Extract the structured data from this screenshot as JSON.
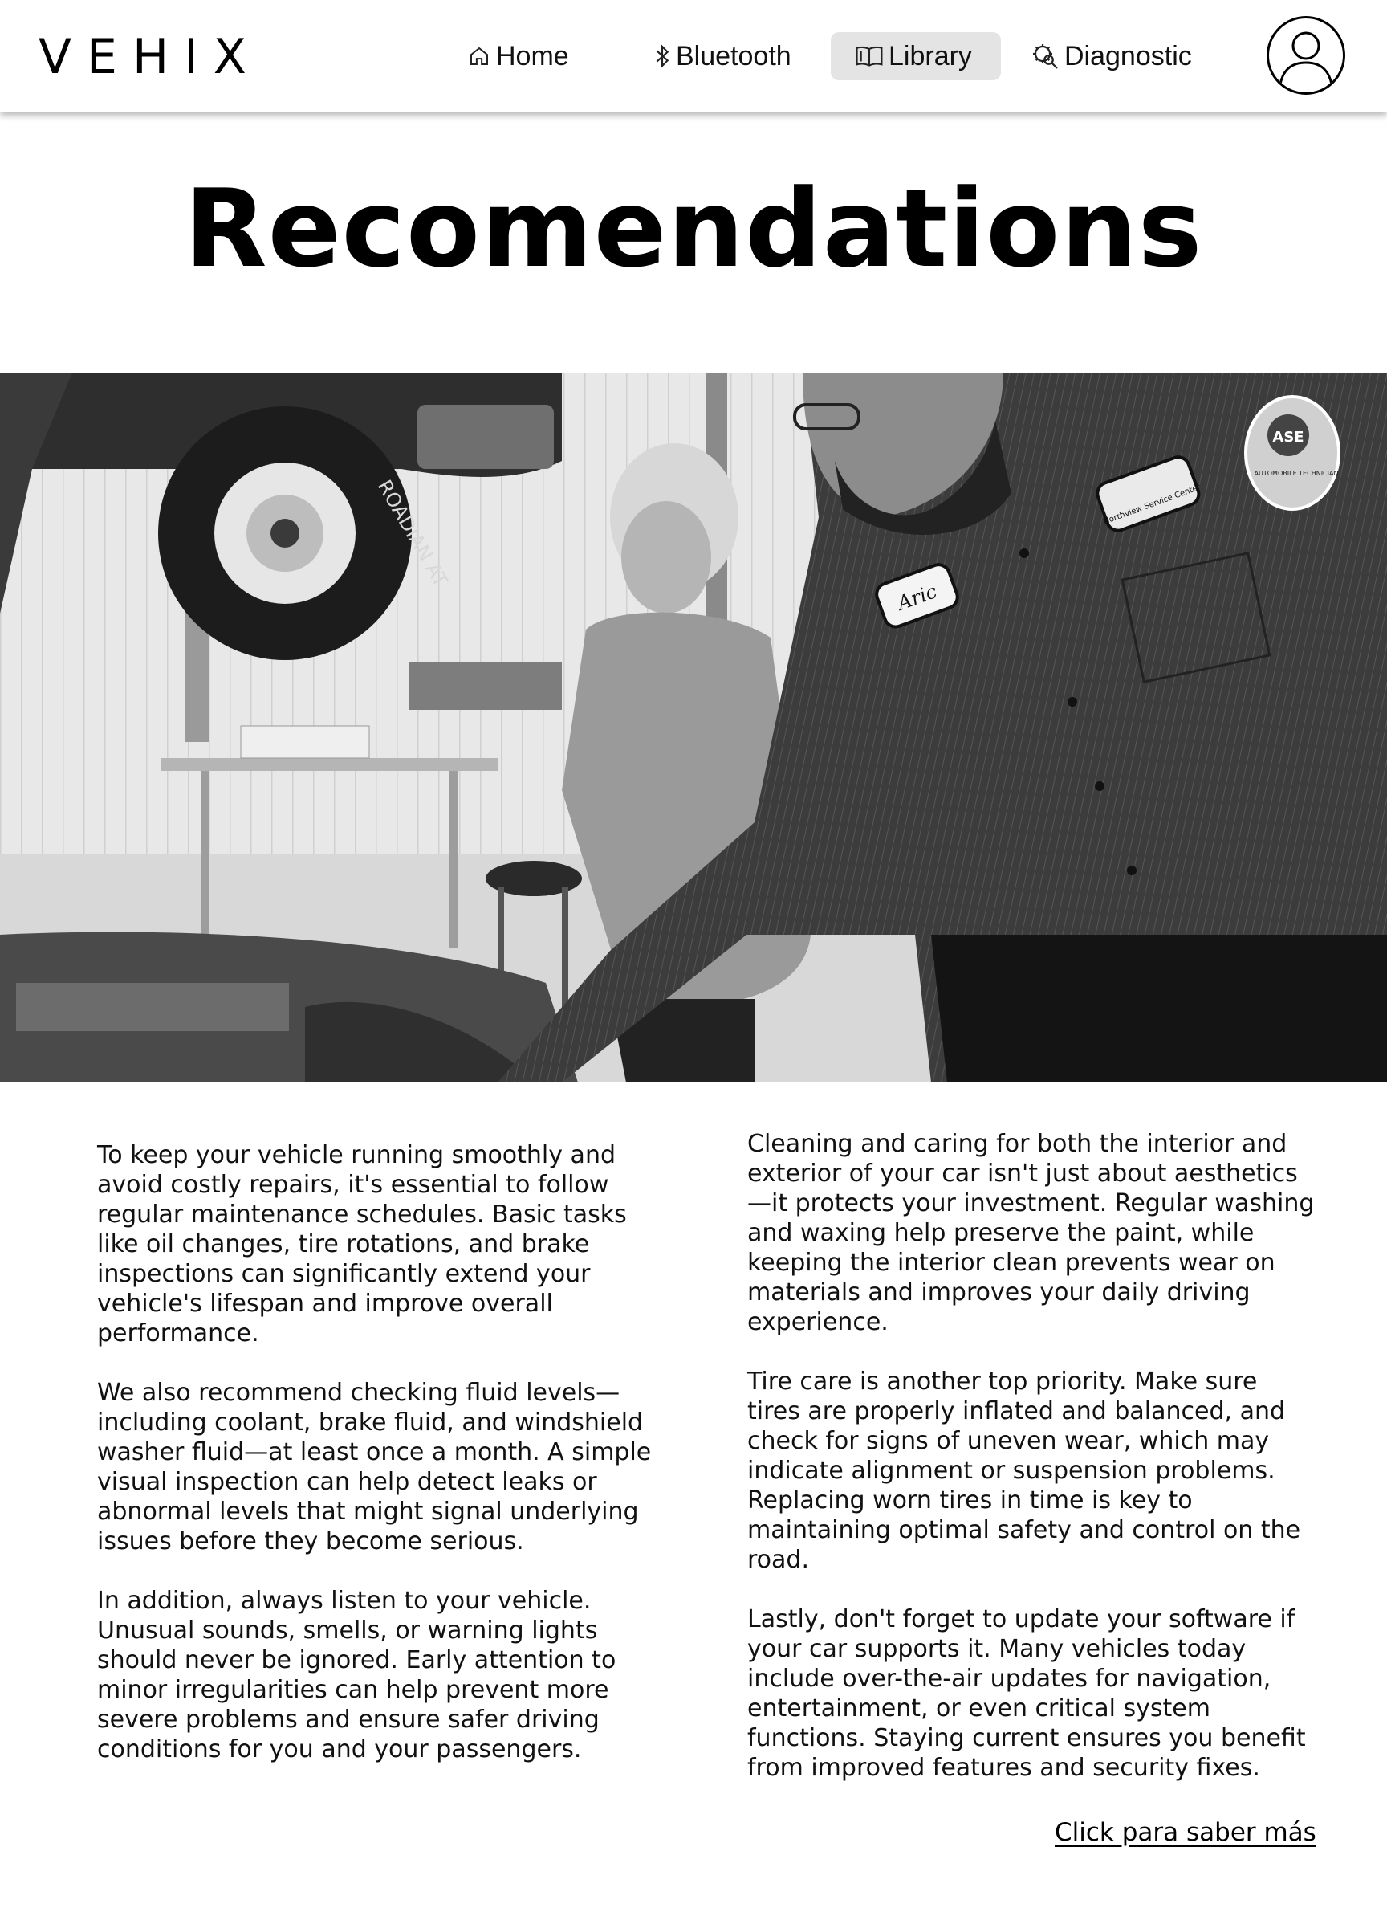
{
  "header": {
    "logo": "VEHIX",
    "nav": [
      {
        "label": "Home",
        "icon": "home-icon",
        "active": false
      },
      {
        "label": "Bluetooth",
        "icon": "bluetooth-icon",
        "active": false
      },
      {
        "label": "Library",
        "icon": "book-icon",
        "active": true
      },
      {
        "label": "Diagnostic",
        "icon": "diagnostic-icon",
        "active": false
      }
    ],
    "profile_icon": "user-avatar-icon"
  },
  "page": {
    "title": "Recomendations"
  },
  "hero_image": {
    "description": "Black and white photo of a mechanic and an older woman looking under the hood of a car in a repair shop",
    "badge_name": "Aric",
    "patch_text": "Northview Service Center",
    "ase_text": "ASE",
    "ase_subtext": "AUTOMOBILE TECHNICIAN",
    "tire_text": "ROADIAN AT"
  },
  "content": {
    "left": [
      "To keep your vehicle running smoothly and avoid costly repairs, it's essential to follow regular maintenance schedules. Basic tasks like oil changes, tire rotations, and brake inspections can significantly extend your vehicle's lifespan and improve overall performance.",
      "We also recommend checking fluid levels—including coolant, brake fluid, and windshield washer fluid—at least once a month. A simple visual inspection can help detect leaks or abnormal levels that might signal underlying issues before they become serious.",
      "In addition, always listen to your vehicle. Unusual sounds, smells, or warning lights should never be ignored. Early attention to minor irregularities can help prevent more severe problems and ensure safer driving conditions for you and your passengers."
    ],
    "right": [
      "Cleaning and caring for both the interior and exterior of your car isn't just about aesthetics—it protects your investment. Regular washing and waxing help preserve the paint, while keeping the interior clean prevents wear on materials and improves your daily driving experience.",
      "Tire care is another top priority. Make sure tires are properly inflated and balanced, and check for signs of uneven wear, which may indicate alignment or suspension problems. Replacing worn tires in time is key to maintaining optimal safety and control on the road.",
      "Lastly, don't forget to update your software if your car supports it. Many vehicles today include over-the-air updates for navigation, entertainment, or even critical system functions. Staying current ensures you benefit from improved features and security fixes."
    ],
    "link": "Click para saber más"
  },
  "colors": {
    "active_nav_bg": "#e4e4e4",
    "text": "#000000"
  }
}
